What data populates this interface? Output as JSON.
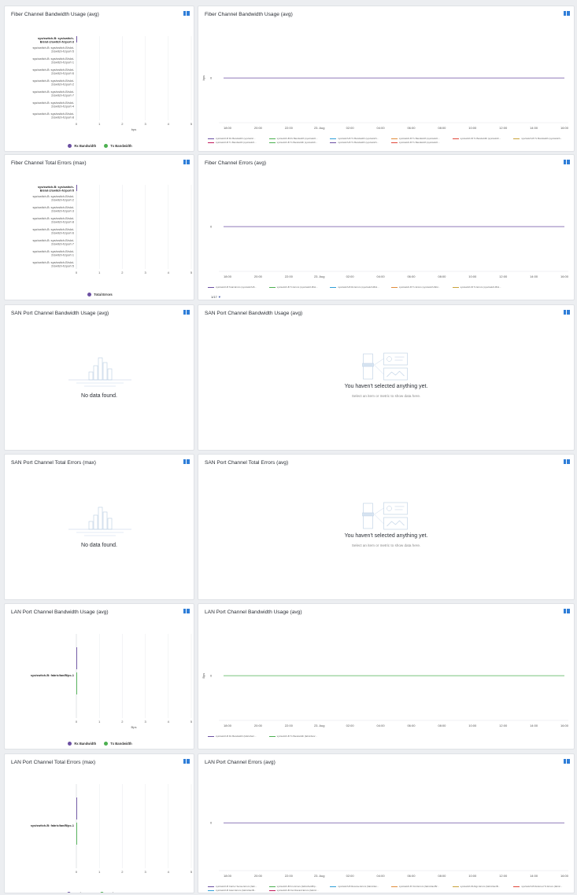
{
  "colors": {
    "rx": "#6b4fa2",
    "tx": "#4cb050",
    "line_purple": "#6b4fa2",
    "accent": "#2f7ed8"
  },
  "rows": [
    {
      "left": {
        "title": "Fiber Channel Bandwidth Usage (avg)",
        "bold_label_lines": [
          "sys/switch-B: sys/switch-",
          "B/slot-2/switch-fc/port-3"
        ],
        "labels": [
          [
            "sys/switch-B: sys/switch-B/slot-",
            "2/switch-fc/port-5"
          ],
          [
            "sys/switch-B: sys/switch-B/slot-",
            "2/switch-fc/port-1"
          ],
          [
            "sys/switch-B: sys/switch-B/slot-",
            "2/switch-fc/port-6"
          ],
          [
            "sys/switch-B: sys/switch-B/slot-",
            "2/switch-fc/port-2"
          ],
          [
            "sys/switch-B: sys/switch-B/slot-",
            "2/switch-fc/port-7"
          ],
          [
            "sys/switch-B: sys/switch-B/slot-",
            "2/switch-fc/port-4"
          ],
          [
            "sys/switch-B: sys/switch-B/slot-",
            "2/switch-fc/port-8"
          ]
        ],
        "ticks": [
          "0",
          "1",
          "2",
          "3",
          "4",
          "5"
        ],
        "xunit": "bps",
        "legend": [
          {
            "name": "Rx Bandwidth",
            "color": "#6b4fa2"
          },
          {
            "name": "Tx Bandwidth",
            "color": "#4cb050"
          }
        ]
      },
      "right": {
        "title": "Fiber Channel Bandwidth Usage (avg)",
        "yunit": "bps",
        "zero": "0",
        "times": [
          "18:00",
          "20:00",
          "22:00",
          "23. Aug",
          "02:00",
          "04:00",
          "06:00",
          "08:00",
          "10:00",
          "12:00",
          "14:00",
          "16:00"
        ],
        "legend": [
          {
            "name": "sys/switch-B Rx Bandwidth (sys/switc...",
            "color": "#6b4fa2"
          },
          {
            "name": "sys/switch-B Rx Bandwidth (sys/switch...",
            "color": "#4cb050"
          },
          {
            "name": "sys/switch-B Tx Bandwidth (sys/switch...",
            "color": "#2f9fd8"
          },
          {
            "name": "sys/switch-B Tx Bandwidth (sys/switch...",
            "color": "#e08c3a"
          },
          {
            "name": "sys/switch-B Tx Bandwidth (sys/switch...",
            "color": "#e0473a"
          },
          {
            "name": "sys/switch-B Tx Bandwidth (sys/switch...",
            "color": "#c8a23a"
          },
          {
            "name": "sys/switch-B Tx Bandwidth (sys/switch...",
            "color": "#c2185b"
          },
          {
            "name": "sys/switch-B Tx Bandwidth (sys/switch...",
            "color": "#4cb050"
          },
          {
            "name": "sys/switch-B Tx Bandwidth (sys/switch...",
            "color": "#6b4fa2"
          },
          {
            "name": "sys/switch-B Tx Bandwidth (sys/switch...",
            "color": "#e0473a"
          }
        ]
      }
    },
    {
      "left": {
        "title": "Fiber Channel Total Errors (max)",
        "bold_label_lines": [
          "sys/switch-B: sys/switch-",
          "B/slot-2/switch-fc/port-5"
        ],
        "labels": [
          [
            "sys/switch-B: sys/switch-B/slot-",
            "2/switch-fc/port-2"
          ],
          [
            "sys/switch-B: sys/switch-B/slot-",
            "2/switch-fc/port-3"
          ],
          [
            "sys/switch-B: sys/switch-B/slot-",
            "2/switch-fc/port-8"
          ],
          [
            "sys/switch-B: sys/switch-B/slot-",
            "2/switch-fc/port-6"
          ],
          [
            "sys/switch-B: sys/switch-B/slot-",
            "2/switch-fc/port-7"
          ],
          [
            "sys/switch-B: sys/switch-B/slot-",
            "2/switch-fc/port-1"
          ],
          [
            "sys/switch-B: sys/switch-B/slot-",
            "2/switch-fc/port-5"
          ]
        ],
        "ticks": [
          "0",
          "1",
          "2",
          "3",
          "4",
          "5"
        ],
        "xunit": "",
        "legend": [
          {
            "name": "Total Errors",
            "color": "#6b4fa2"
          }
        ]
      },
      "right": {
        "title": "Fiber Channel Errors (avg)",
        "yunit": "",
        "zero": "0",
        "times": [
          "18:00",
          "20:00",
          "22:00",
          "23. Aug",
          "02:00",
          "04:00",
          "06:00",
          "08:00",
          "10:00",
          "12:00",
          "14:00",
          "16:00"
        ],
        "legend": [
          {
            "name": "sys/switch-B Total Errors (sys/switch-B...",
            "color": "#6b4fa2"
          },
          {
            "name": "sys/switch-B Tx Errors (sys/switch-B/sl...",
            "color": "#4cb050"
          },
          {
            "name": "sys/switch-B Rx Errors (sys/switch-B/sl...",
            "color": "#2f9fd8"
          },
          {
            "name": "sys/switch-B Tx Errors (sys/switch-B/sl...",
            "color": "#e08c3a"
          },
          {
            "name": "sys/switch-B Tx Errors (sys/switch-B/sl...",
            "color": "#c8a23a"
          }
        ],
        "pager": "1/17"
      }
    },
    {
      "left": {
        "title": "SAN Port Channel Bandwidth Usage (avg)",
        "nodata": "No data found."
      },
      "right": {
        "title": "SAN Port Channel Bandwidth Usage (avg)",
        "empty_title": "You haven't selected anything yet.",
        "empty_sub": "Select an item or metric to show data here."
      }
    },
    {
      "left": {
        "title": "SAN Port Channel Total Errors (max)",
        "nodata": "No data found."
      },
      "right": {
        "title": "SAN Port Channel Total Errors (avg)",
        "empty_title": "You haven't selected anything yet.",
        "empty_sub": "Select an item or metric to show data here."
      }
    },
    {
      "left": {
        "title": "LAN Port Channel Bandwidth Usage (avg)",
        "single_label": "sys/switch-B: fabric/lan/B/pc-1",
        "ticks": [
          "0",
          "1",
          "2",
          "3",
          "4",
          "5"
        ],
        "xunit": "Bps",
        "legend": [
          {
            "name": "Rx Bandwidth",
            "color": "#6b4fa2"
          },
          {
            "name": "Tx Bandwidth",
            "color": "#4cb050"
          }
        ]
      },
      "right": {
        "title": "LAN Port Channel Bandwidth Usage (avg)",
        "yunit": "Bps",
        "zero": "0",
        "times": [
          "18:00",
          "20:00",
          "22:00",
          "23. Aug",
          "02:00",
          "04:00",
          "06:00",
          "08:00",
          "10:00",
          "12:00",
          "14:00",
          "16:00"
        ],
        "legend": [
          {
            "name": "sys/switch-B Rx Bandwidth (fabric/lan/...",
            "color": "#6b4fa2"
          },
          {
            "name": "sys/switch-B Tx Bandwidth (fabric/lan/...",
            "color": "#4cb050"
          }
        ]
      }
    },
    {
      "left": {
        "title": "LAN Port Channel Total Errors (max)",
        "single_label": "sys/switch-B: fabric/lan/B/pc-1",
        "ticks": [
          "0",
          "1",
          "2",
          "3",
          "4",
          "5"
        ],
        "xunit": "",
        "legend": [
          {
            "name": "Total Errors",
            "color": "#6b4fa2"
          },
          {
            "name": "Total Loss Errors",
            "color": "#4cb050"
          }
        ]
      },
      "right": {
        "title": "LAN Port Channel Errors (avg)",
        "yunit": "",
        "zero": "0",
        "times": [
          "18:00",
          "20:00",
          "22:00",
          "23. Aug",
          "02:00",
          "04:00",
          "06:00",
          "08:00",
          "10:00",
          "12:00",
          "14:00",
          "16:00"
        ],
        "legend": [
          {
            "name": "sys/switch-B Carrier Sense Errors (fabr...",
            "color": "#6b4fa2"
          },
          {
            "name": "sys/switch-B Fcs Errors (fabric/lan/B/p...",
            "color": "#4cb050"
          },
          {
            "name": "sys/switch-B Receive Errors (fabric/lan...",
            "color": "#2f9fd8"
          },
          {
            "name": "sys/switch-B Xmit Errors (fabric/lan/B/...",
            "color": "#e08c3a"
          },
          {
            "name": "sys/switch-B Align Errors (fabric/lan/B...",
            "color": "#c8a23a"
          },
          {
            "name": "sys/switch-B Deferred Tx Errors (fabric...",
            "color": "#e0473a"
          },
          {
            "name": "sys/switch-B Giant Errors (fabric/lan/B...",
            "color": "#2f9fd8"
          },
          {
            "name": "sys/switch-B Out Discard Errors (fabric/...",
            "color": "#c2185b"
          }
        ]
      }
    }
  ]
}
